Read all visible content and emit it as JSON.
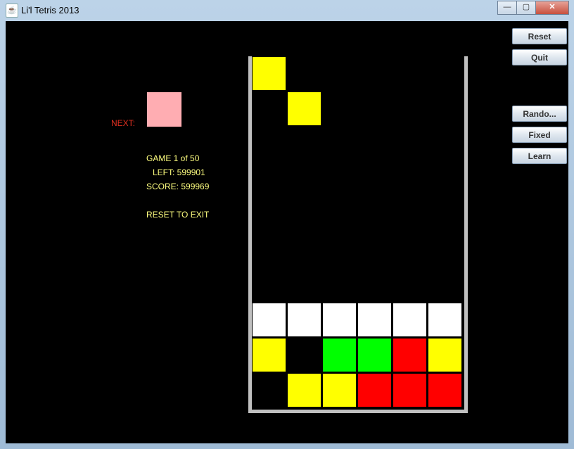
{
  "window": {
    "title": "Li'l Tetris 2013",
    "controls": [
      "minimize",
      "maximize",
      "close"
    ]
  },
  "sidebar_buttons": [
    {
      "id": "reset",
      "label": "Reset"
    },
    {
      "id": "quit",
      "label": "Quit"
    },
    {
      "id": "random",
      "label": "Rando..."
    },
    {
      "id": "fixed",
      "label": "Fixed"
    },
    {
      "id": "learn",
      "label": "Learn"
    }
  ],
  "next": {
    "label": "NEXT:",
    "color": "#ffadb2"
  },
  "status": {
    "game": "GAME 1 of 50",
    "left": "LEFT: 599901",
    "score": "SCORE: 599969",
    "reset_hint": "RESET TO EXIT"
  },
  "colors": {
    "Y": "#ffff00",
    "W": "#ffffff",
    "G": "#00ff00",
    "R": "#ff0000",
    "wall": "#c0c0c0"
  },
  "board": {
    "columns": 6,
    "rows": 10,
    "falling_piece": [
      {
        "row": 0,
        "col": 0,
        "color": "Y"
      },
      {
        "row": 1,
        "col": 1,
        "color": "Y"
      }
    ],
    "stack": [
      [
        "W",
        "W",
        "W",
        "W",
        "W",
        "W"
      ],
      [
        "Y",
        "",
        "G",
        "G",
        "R",
        "Y"
      ],
      [
        "",
        "Y",
        "Y",
        "R",
        "R",
        "R"
      ]
    ]
  }
}
